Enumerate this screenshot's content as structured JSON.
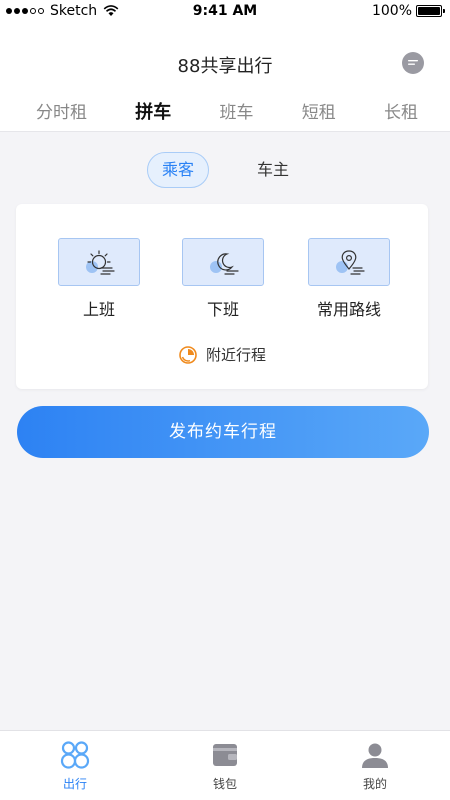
{
  "status_bar": {
    "carrier": "Sketch",
    "time": "9:41 AM",
    "battery": "100%",
    "signal_dots_filled": 3,
    "signal_dots_total": 5,
    "battery_level": 1.0
  },
  "header": {
    "title": "88共享出行",
    "message_icon": "chat-bubble-icon",
    "tabs": [
      {
        "label": "分时租",
        "active": false
      },
      {
        "label": "拼车",
        "active": true
      },
      {
        "label": "班车",
        "active": false
      },
      {
        "label": "短租",
        "active": false
      },
      {
        "label": "长租",
        "active": false
      }
    ]
  },
  "role_switch": [
    {
      "label": "乘客",
      "active": true
    },
    {
      "label": "车主",
      "active": false
    }
  ],
  "card": {
    "options": [
      {
        "label": "上班",
        "icon": "sun-clouds-icon"
      },
      {
        "label": "下班",
        "icon": "moon-clouds-icon"
      },
      {
        "label": "常用路线",
        "icon": "location-pin-icon"
      }
    ],
    "nearby_label": "附近行程",
    "nearby_icon": "radar-icon"
  },
  "publish_button": "发布约车行程",
  "bottom_nav": [
    {
      "label": "出行",
      "icon": "88-logo-icon",
      "active": true
    },
    {
      "label": "钱包",
      "icon": "wallet-icon",
      "active": false
    },
    {
      "label": "我的",
      "icon": "user-icon",
      "active": false
    }
  ],
  "colors": {
    "accent": "#2a82f5",
    "accent_light": "#e6f0fd",
    "orange": "#f08a1c",
    "background": "#f4f4f7"
  }
}
